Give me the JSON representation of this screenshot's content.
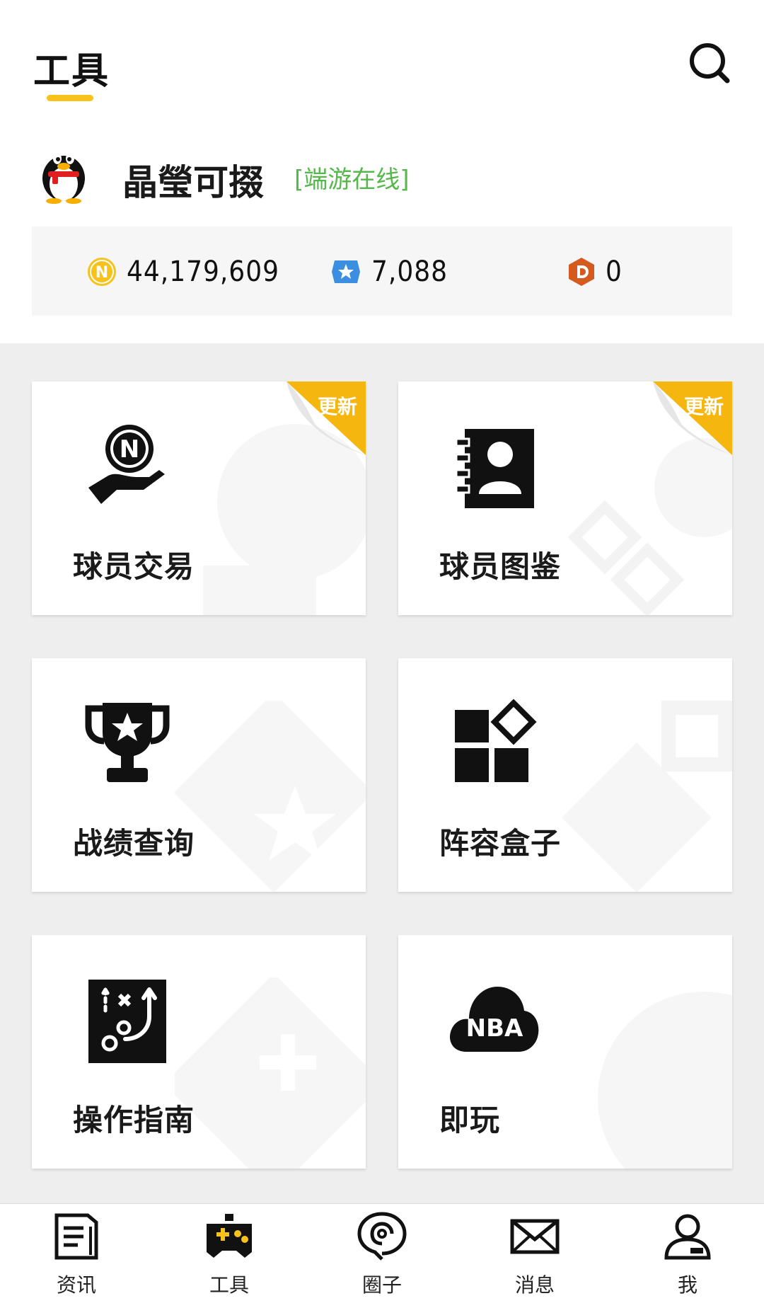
{
  "header": {
    "title": "工具"
  },
  "profile": {
    "nickname": "晶瑩可掇",
    "status": "[端游在线]"
  },
  "stats": [
    {
      "icon": "n-coin-icon",
      "value": "44,179,609",
      "color": "#f7c21b"
    },
    {
      "icon": "star-badge-icon",
      "value": "7,088",
      "color": "#3c8fe0"
    },
    {
      "icon": "d-hex-icon",
      "value": "0",
      "color": "#d45a1f"
    }
  ],
  "tools": [
    {
      "label": "球员交易",
      "icon": "hand-coin-icon",
      "badge": "更新"
    },
    {
      "label": "球员图鉴",
      "icon": "contact-book-icon",
      "badge": "更新"
    },
    {
      "label": "战绩查询",
      "icon": "trophy-icon"
    },
    {
      "label": "阵容盒子",
      "icon": "blocks-icon"
    },
    {
      "label": "操作指南",
      "icon": "tactics-board-icon"
    },
    {
      "label": "即玩",
      "icon": "nba-cloud-icon",
      "icon_text": "NBA"
    }
  ],
  "nav": [
    {
      "label": "资讯",
      "icon": "news-icon",
      "active": false
    },
    {
      "label": "工具",
      "icon": "gamepad-icon",
      "active": true
    },
    {
      "label": "圈子",
      "icon": "circle-pin-icon",
      "active": false
    },
    {
      "label": "消息",
      "icon": "mail-icon",
      "active": false
    },
    {
      "label": "我",
      "icon": "user-icon",
      "active": false
    }
  ],
  "colors": {
    "accent": "#f7c21b",
    "online": "#55b84a",
    "grid_bg": "#eeeeee"
  }
}
